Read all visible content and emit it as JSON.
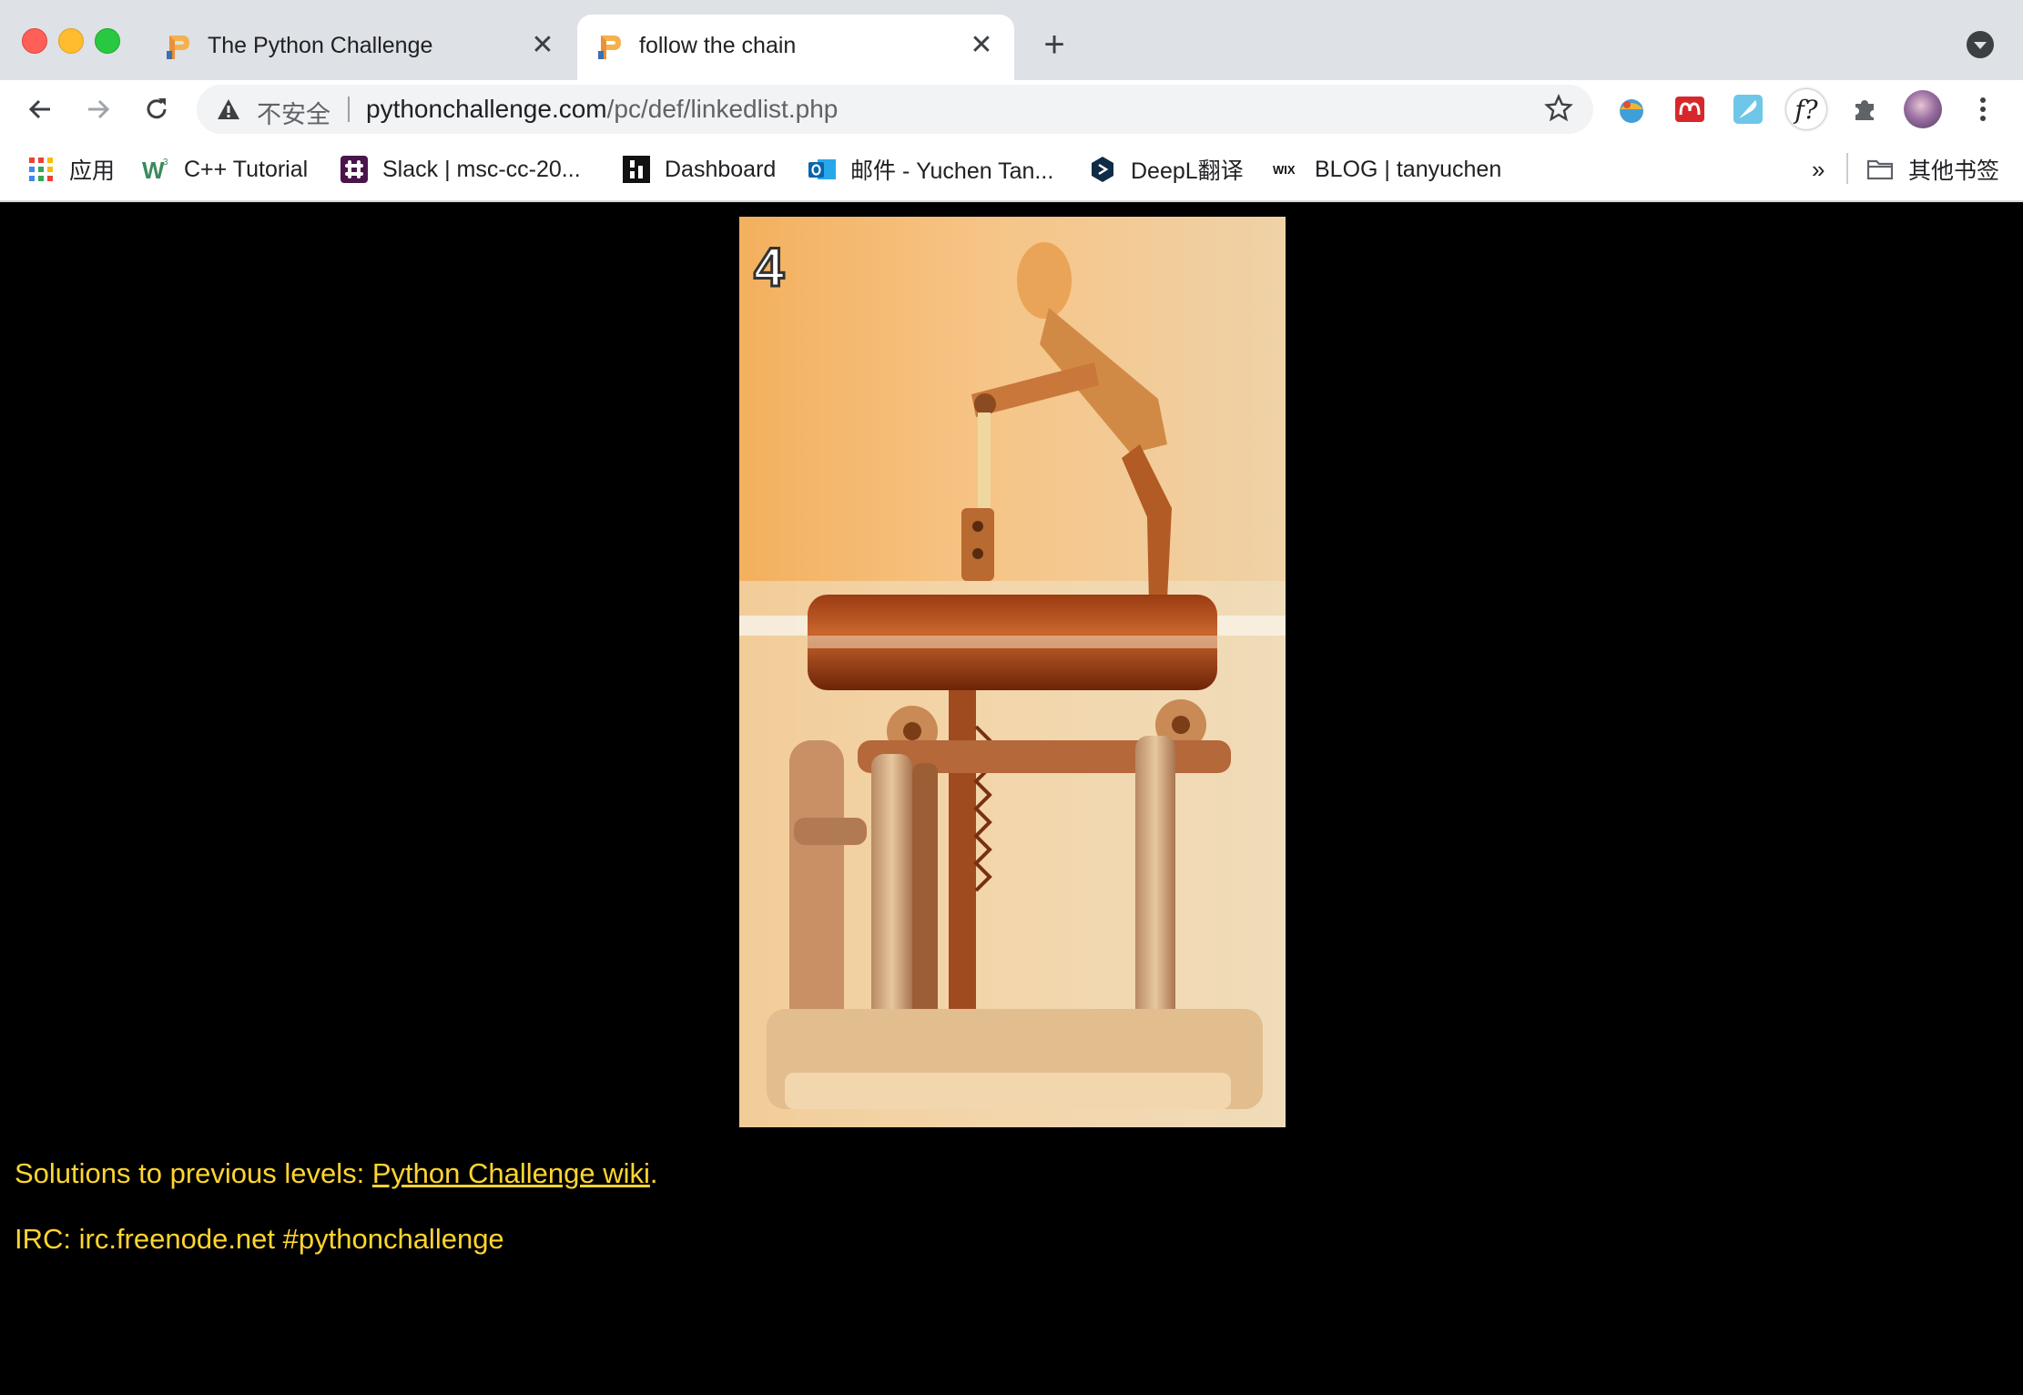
{
  "tabs": [
    {
      "title": "The Python Challenge",
      "active": false
    },
    {
      "title": "follow the chain",
      "active": true
    }
  ],
  "addressbar": {
    "security_label": "不安全",
    "url_host": "pythonchallenge.com",
    "url_path": "/pc/def/linkedlist.php"
  },
  "bookmarks": [
    {
      "label": "应用",
      "icon": "apps-grid-icon"
    },
    {
      "label": "C++ Tutorial",
      "icon": "w3schools-icon"
    },
    {
      "label": "Slack | msc-cc-20...",
      "icon": "slack-icon"
    },
    {
      "label": "Dashboard",
      "icon": "dashboard-icon"
    },
    {
      "label": "邮件 - Yuchen Tan...",
      "icon": "outlook-icon"
    },
    {
      "label": "DeepL翻译",
      "icon": "deepl-icon"
    },
    {
      "label": "BLOG | tanyuchen",
      "icon": "wix-icon"
    }
  ],
  "bookmarks_overflow": "»",
  "other_bookmarks": "其他书签",
  "extensions": [
    "colorful-extension-icon",
    "mendeley-icon",
    "feather-extension-icon",
    "function-extension-icon",
    "puzzle-icon"
  ],
  "extension_function_label": "f?",
  "page": {
    "puzzle_number": "4",
    "solutions_prefix": "Solutions to previous levels: ",
    "solutions_link": "Python Challenge wiki",
    "solutions_suffix": ".",
    "irc": "IRC: irc.freenode.net #pythonchallenge"
  },
  "colors": {
    "page_background": "#000000",
    "page_text": "#ffd52f",
    "tabstrip": "#dee1e6"
  }
}
